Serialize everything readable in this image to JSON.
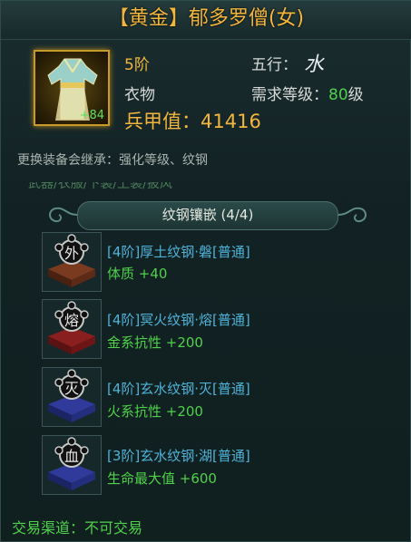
{
  "title": "【黄金】郁多罗僧(女)",
  "item": {
    "enhance_badge": "+84",
    "tier": "5阶",
    "element_label": "五行：",
    "element_glyph": "水",
    "category": "衣物",
    "level_label": "需求等级：",
    "level_value": "80",
    "level_unit": "级",
    "armor_label": "兵甲值：",
    "armor_value": "41416"
  },
  "inherit_text": "更换装备会继承：强化等级、纹钢",
  "cut_text": "武器/衣服/下装/上装/披风",
  "section_title": "纹钢镶嵌 (4/4)",
  "gems": [
    {
      "glyph": "外",
      "name": "[4阶]厚土纹钢·磐[普通]",
      "stat": "体质   +40",
      "color": "#7a3a1f"
    },
    {
      "glyph": "熔",
      "name": "[4阶]冥火纹钢·熔[普通]",
      "stat": "金系抗性   +200",
      "color": "#8a1f1f"
    },
    {
      "glyph": "灭",
      "name": "[4阶]玄水纹钢·灭[普通]",
      "stat": "火系抗性   +200",
      "color": "#2f3a9a"
    },
    {
      "glyph": "血",
      "name": "[3阶]玄水纹钢·湖[普通]",
      "stat": "生命最大值   +600",
      "color": "#2f3a9a"
    }
  ],
  "trade_text": "交易渠道：不可交易"
}
